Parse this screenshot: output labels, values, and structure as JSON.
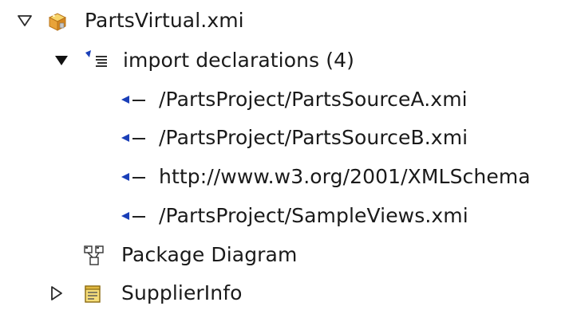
{
  "tree": {
    "root": {
      "label": "PartsVirtual.xmi",
      "expanded": true,
      "icon": "model-package-icon"
    },
    "imports": {
      "label": "import declarations (4)",
      "expanded": true,
      "icon": "import-declarations-icon",
      "items": [
        {
          "label": "/PartsProject/PartsSourceA.xmi",
          "icon": "import-reference-icon"
        },
        {
          "label": "/PartsProject/PartsSourceB.xmi",
          "icon": "import-reference-icon"
        },
        {
          "label": "http://www.w3.org/2001/XMLSchema",
          "icon": "import-reference-icon"
        },
        {
          "label": "/PartsProject/SampleViews.xmi",
          "icon": "import-reference-icon"
        }
      ]
    },
    "diagram": {
      "label": "Package Diagram",
      "icon": "package-diagram-icon"
    },
    "supplier": {
      "label": "SupplierInfo",
      "expanded": false,
      "icon": "table-icon"
    }
  },
  "colors": {
    "import_arrow": "#1a3fb8",
    "model_orange": "#e59a2a",
    "model_yellow": "#f5cc55"
  }
}
